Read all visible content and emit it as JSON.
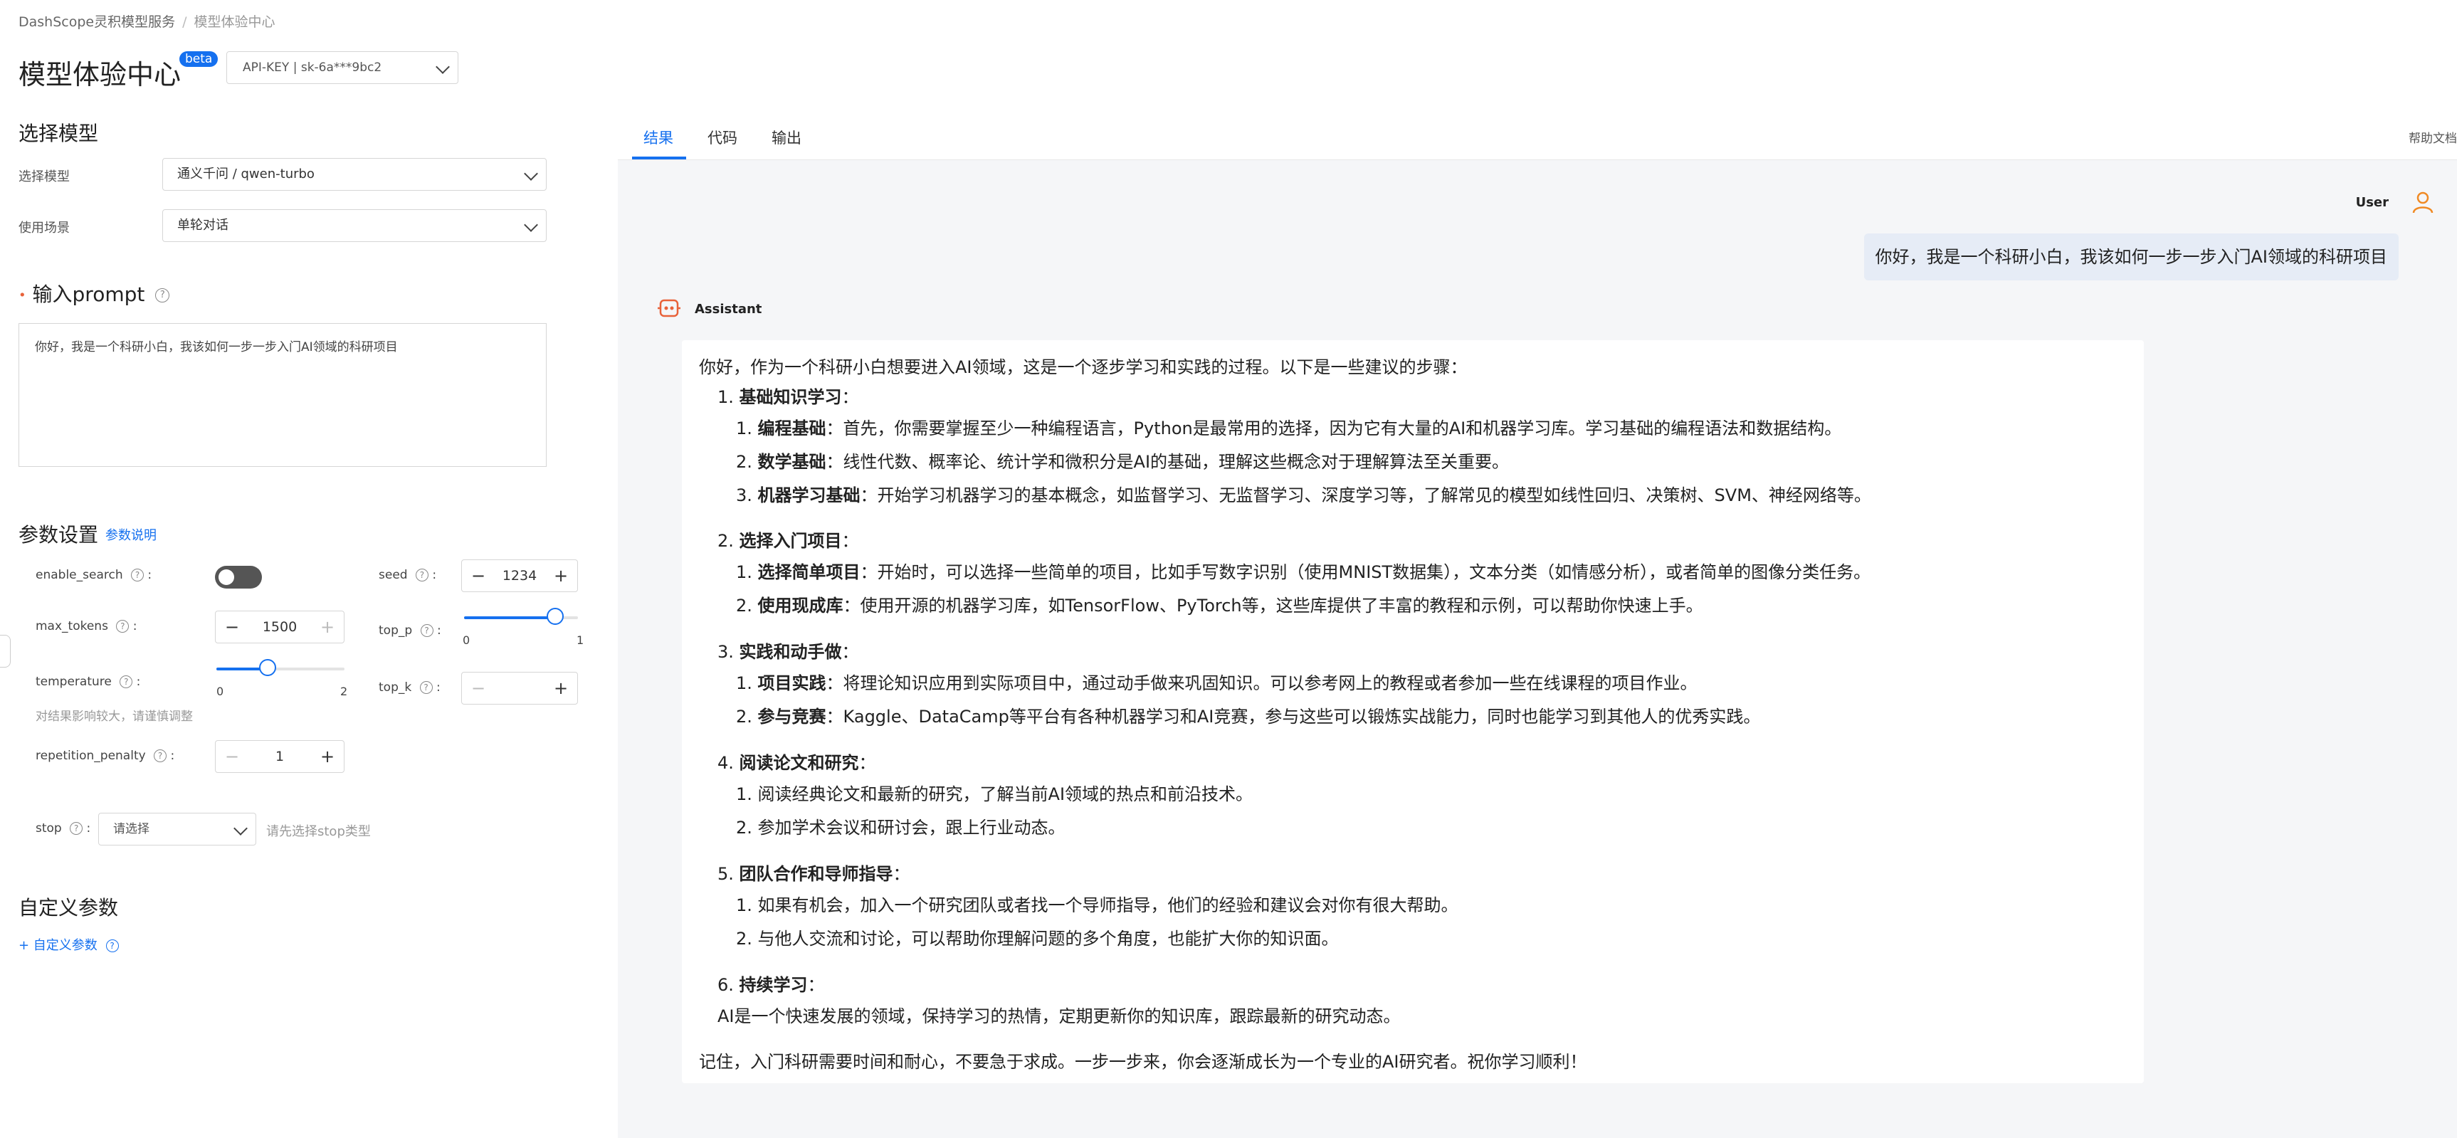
{
  "breadcrumb": {
    "root": "DashScope灵积模型服务",
    "sep": "/",
    "current": "模型体验中心"
  },
  "header": {
    "title": "模型体验中心",
    "badge": "beta",
    "api_key": "API-KEY |   sk-6a***9bc2"
  },
  "model_section": {
    "title": "选择模型",
    "model_label": "选择模型",
    "model_value": "通义千问 / qwen-turbo",
    "scene_label": "使用场景",
    "scene_value": "单轮对话"
  },
  "prompt": {
    "required_mark": "•",
    "title": "输入prompt",
    "text": "你好，我是一个科研小白，我该如何一步一步入门AI领域的科研项目"
  },
  "params": {
    "title": "参数设置",
    "help_link": "参数说明",
    "enable_search": "enable_search",
    "max_tokens": "max_tokens",
    "max_tokens_value": "1500",
    "temperature": "temperature",
    "temperature_hint": "对结果影响较大，请谨慎调整",
    "temperature_min": "0",
    "temperature_max": "2",
    "temperature_level": 0.4,
    "repetition_penalty": "repetition_penalty",
    "repetition_penalty_value": "1",
    "seed": "seed",
    "seed_value": "1234",
    "top_p": "top_p",
    "top_p_min": "0",
    "top_p_max": "1",
    "top_p_level": 0.8,
    "top_k": "top_k",
    "stop": "stop",
    "stop_placeholder": "请选择",
    "stop_hint": "请先选择stop类型",
    "colon": ":"
  },
  "custom": {
    "title": "自定义参数",
    "add_link": "+ 自定义参数"
  },
  "tabs": {
    "result": "结果",
    "code": "代码",
    "output": "输出",
    "help": "帮助文档"
  },
  "chat": {
    "user_label": "User",
    "user_message": "你好，我是一个科研小白，我该如何一步一步入门AI领域的科研项目",
    "assistant_label": "Assistant",
    "intro": "你好，作为一个科研小白想要进入AI领域，这是一个逐步学习和实践的过程。以下是一些建议的步骤：",
    "s1_num": "1.",
    "s1_title": "基础知识学习",
    "s1_1_num": "1.",
    "s1_1_b": "编程基础",
    "s1_1_t": "：首先，你需要掌握至少一种编程语言，Python是最常用的选择，因为它有大量的AI和机器学习库。学习基础的编程语法和数据结构。",
    "s1_2_num": "2.",
    "s1_2_b": "数学基础",
    "s1_2_t": "：线性代数、概率论、统计学和微积分是AI的基础，理解这些概念对于理解算法至关重要。",
    "s1_3_num": "3.",
    "s1_3_b": "机器学习基础",
    "s1_3_t": "：开始学习机器学习的基本概念，如监督学习、无监督学习、深度学习等，了解常见的模型如线性回归、决策树、SVM、神经网络等。",
    "s2_num": "2.",
    "s2_title": "选择入门项目",
    "s2_1_num": "1.",
    "s2_1_b": "选择简单项目",
    "s2_1_t": "：开始时，可以选择一些简单的项目，比如手写数字识别（使用MNIST数据集），文本分类（如情感分析），或者简单的图像分类任务。",
    "s2_2_num": "2.",
    "s2_2_b": "使用现成库",
    "s2_2_t": "：使用开源的机器学习库，如TensorFlow、PyTorch等，这些库提供了丰富的教程和示例，可以帮助你快速上手。",
    "s3_num": "3.",
    "s3_title": "实践和动手做",
    "s3_1_num": "1.",
    "s3_1_b": "项目实践",
    "s3_1_t": "：将理论知识应用到实际项目中，通过动手做来巩固知识。可以参考网上的教程或者参加一些在线课程的项目作业。",
    "s3_2_num": "2.",
    "s3_2_b": "参与竞赛",
    "s3_2_t": "：Kaggle、DataCamp等平台有各种机器学习和AI竞赛，参与这些可以锻炼实战能力，同时也能学习到其他人的优秀实践。",
    "s4_num": "4.",
    "s4_title": "阅读论文和研究",
    "s4_1": "1. 阅读经典论文和最新的研究，了解当前AI领域的热点和前沿技术。",
    "s4_2": "2. 参加学术会议和研讨会，跟上行业动态。",
    "s5_num": "5.",
    "s5_title": "团队合作和导师指导",
    "s5_1": "1. 如果有机会，加入一个研究团队或者找一个导师指导，他们的经验和建议会对你有很大帮助。",
    "s5_2": "2. 与他人交流和讨论，可以帮助你理解问题的多个角度，也能扩大你的知识面。",
    "s6_num": "6.",
    "s6_title": "持续学习",
    "s6_text": "AI是一个快速发展的领域，保持学习的热情，定期更新你的知识库，跟踪最新的研究动态。",
    "closing": "记住，入门科研需要时间和耐心，不要急于求成。一步一步来，你会逐渐成长为一个专业的AI研究者。祝你学习顺利！",
    "colon": "："
  },
  "colors": {
    "accent": "#1570ef",
    "panel_bg": "#f5f6f8",
    "bubble_bg": "#e6ecf6",
    "assistant_icon": "#e8623a",
    "user_icon": "#f08a24"
  }
}
